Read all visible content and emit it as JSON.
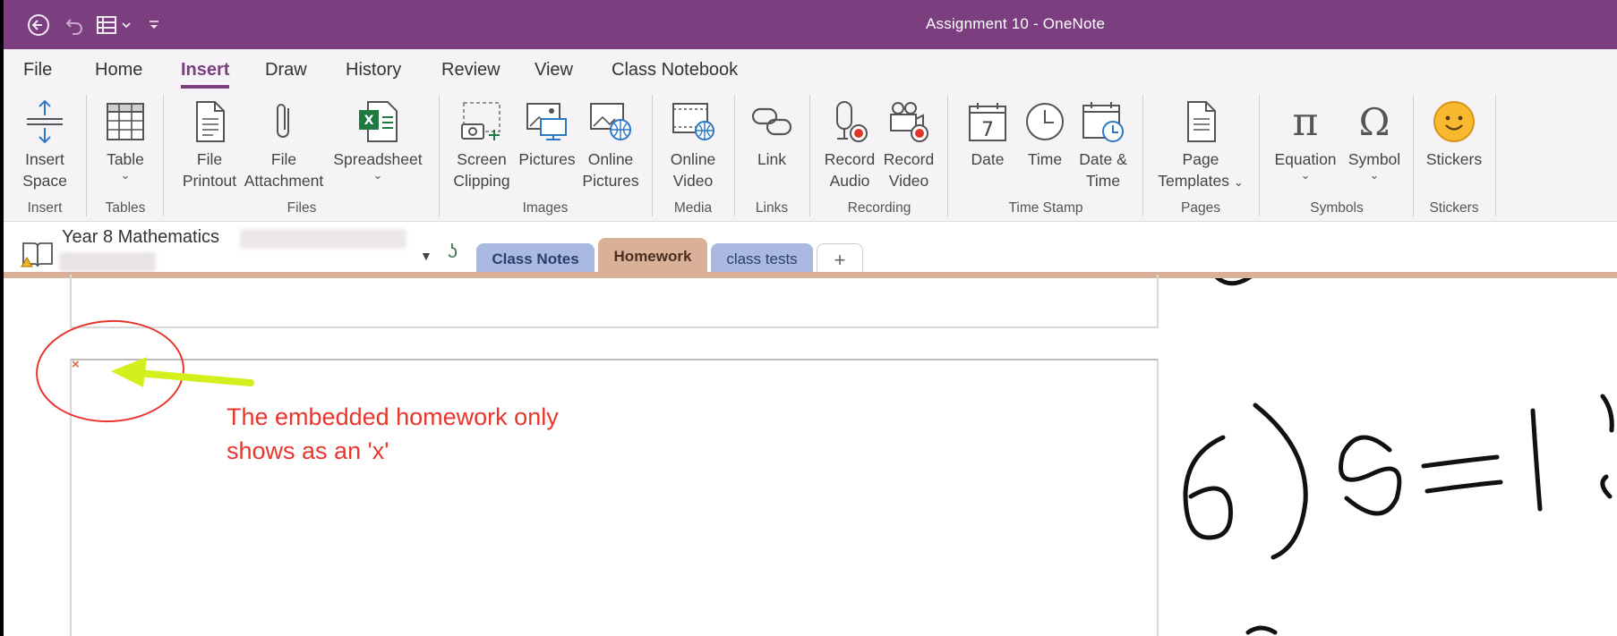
{
  "window": {
    "title": "Assignment 10  -  OneNote",
    "titlebar_color": "#7b3f7f"
  },
  "quick_access": [
    {
      "name": "back-icon"
    },
    {
      "name": "undo-icon"
    },
    {
      "name": "view-icon"
    },
    {
      "name": "customize-icon"
    }
  ],
  "menu": {
    "tabs": [
      "File",
      "Home",
      "Insert",
      "Draw",
      "History",
      "Review",
      "View",
      "Class Notebook"
    ],
    "active": "Insert"
  },
  "ribbon": {
    "buttons": {
      "insert_space": "Insert\nSpace",
      "table": "Table",
      "file_printout": "File\nPrintout",
      "file_attachment": "File\nAttachment",
      "spreadsheet": "Spreadsheet",
      "screen_clipping": "Screen\nClipping",
      "pictures": "Pictures",
      "online_pictures": "Online\nPictures",
      "online_video": "Online\nVideo",
      "link": "Link",
      "record_audio": "Record\nAudio",
      "record_video": "Record\nVideo",
      "date": "Date",
      "date_icon_day": "7",
      "time": "Time",
      "date_time": "Date &\nTime",
      "page_templates": "Page\nTemplates",
      "equation": "Equation",
      "symbol": "Symbol",
      "stickers": "Stickers"
    },
    "groups": {
      "insert": "Insert",
      "tables": "Tables",
      "files": "Files",
      "images": "Images",
      "media": "Media",
      "links": "Links",
      "recording": "Recording",
      "time_stamp": "Time Stamp",
      "pages": "Pages",
      "symbols": "Symbols",
      "stickers": "Stickers"
    }
  },
  "notebook": {
    "name": "Year 8 Mathematics",
    "sections": [
      {
        "label": "Class Notes",
        "color": "#a9b9e0",
        "text_color": "#2c3e6b"
      },
      {
        "label": "Homework",
        "color": "#d9b199",
        "text_color": "#4a2e1f",
        "active": true
      },
      {
        "label": "class tests",
        "color": "#a9b9e0",
        "text_color": "#2c3e6b"
      },
      {
        "label": "+",
        "color": "#ffffff",
        "text_color": "#666666"
      }
    ]
  },
  "page": {
    "broken_embed_glyph": "×",
    "annotation": "The embedded homework only\nshows as an 'x'",
    "annotation_color": "#e8362f",
    "arrow_color": "#d4f01c"
  }
}
